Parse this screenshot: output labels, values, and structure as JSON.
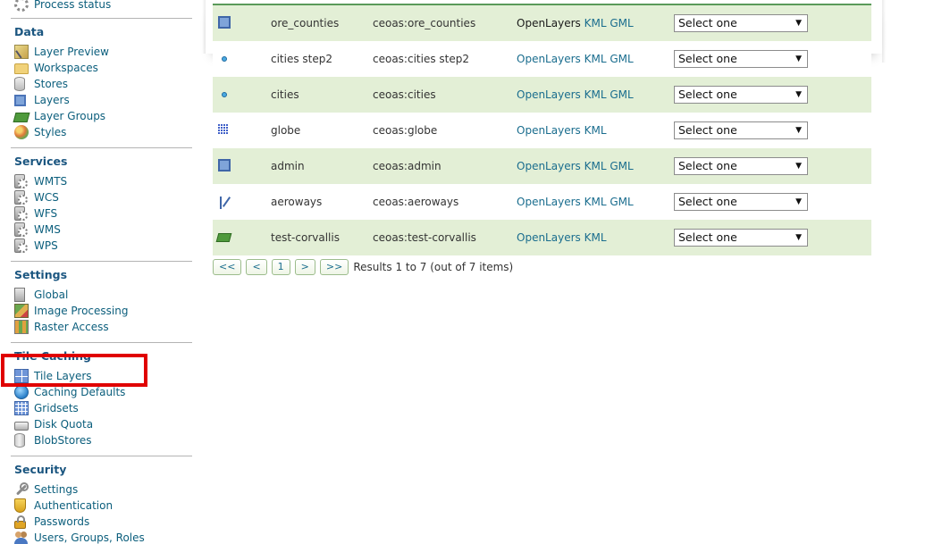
{
  "sidebar": {
    "top_item": {
      "label": "Process status",
      "icon": "gear-icon"
    },
    "sections": {
      "data": {
        "title": "Data",
        "items": [
          {
            "label": "Layer Preview",
            "icon": "layer-preview-icon"
          },
          {
            "label": "Workspaces",
            "icon": "folder-icon"
          },
          {
            "label": "Stores",
            "icon": "store-icon"
          },
          {
            "label": "Layers",
            "icon": "layer-icon"
          },
          {
            "label": "Layer Groups",
            "icon": "layer-group-icon"
          },
          {
            "label": "Styles",
            "icon": "palette-icon"
          }
        ]
      },
      "services": {
        "title": "Services",
        "items": [
          {
            "label": "WMTS",
            "icon": "service-icon"
          },
          {
            "label": "WCS",
            "icon": "service-icon"
          },
          {
            "label": "WFS",
            "icon": "service-icon"
          },
          {
            "label": "WMS",
            "icon": "service-icon"
          },
          {
            "label": "WPS",
            "icon": "service-icon"
          }
        ]
      },
      "settings": {
        "title": "Settings",
        "items": [
          {
            "label": "Global",
            "icon": "server-icon"
          },
          {
            "label": "Image Processing",
            "icon": "image-processing-icon"
          },
          {
            "label": "Raster Access",
            "icon": "raster-icon"
          }
        ]
      },
      "tile_caching": {
        "title": "Tile Caching",
        "items": [
          {
            "label": "Tile Layers",
            "icon": "tile-layers-icon"
          },
          {
            "label": "Caching Defaults",
            "icon": "globe-icon"
          },
          {
            "label": "Gridsets",
            "icon": "grid-icon"
          },
          {
            "label": "Disk Quota",
            "icon": "disk-icon"
          },
          {
            "label": "BlobStores",
            "icon": "blobstore-icon"
          }
        ]
      },
      "security": {
        "title": "Security",
        "items": [
          {
            "label": "Settings",
            "icon": "wrench-icon"
          },
          {
            "label": "Authentication",
            "icon": "shield-icon"
          },
          {
            "label": "Passwords",
            "icon": "lock-icon"
          },
          {
            "label": "Users, Groups, Roles",
            "icon": "users-icon"
          }
        ]
      }
    }
  },
  "layers_table": {
    "rows": [
      {
        "type_icon": "polygon-icon",
        "name": "ore_counties",
        "qualified": "ceoas:ore_counties",
        "openlayers": "OpenLayers",
        "kml": "KML",
        "gml": "GML",
        "select": "Select one"
      },
      {
        "type_icon": "point-icon",
        "name": "cities step2",
        "qualified": "ceoas:cities step2",
        "openlayers": "OpenLayers",
        "kml": "KML",
        "gml": "GML",
        "select": "Select one"
      },
      {
        "type_icon": "point-icon",
        "name": "cities",
        "qualified": "ceoas:cities",
        "openlayers": "OpenLayers",
        "kml": "KML",
        "gml": "GML",
        "select": "Select one"
      },
      {
        "type_icon": "raster-icon",
        "name": "globe",
        "qualified": "ceoas:globe",
        "openlayers": "OpenLayers",
        "kml": "KML",
        "gml": "",
        "select": "Select one"
      },
      {
        "type_icon": "polygon-icon",
        "name": "admin",
        "qualified": "ceoas:admin",
        "openlayers": "OpenLayers",
        "kml": "KML",
        "gml": "GML",
        "select": "Select one"
      },
      {
        "type_icon": "line-icon",
        "name": "aeroways",
        "qualified": "ceoas:aeroways",
        "openlayers": "OpenLayers",
        "kml": "KML",
        "gml": "GML",
        "select": "Select one"
      },
      {
        "type_icon": "layer-group-icon",
        "name": "test-corvallis",
        "qualified": "ceoas:test-corvallis",
        "openlayers": "OpenLayers",
        "kml": "KML",
        "gml": "",
        "select": "Select one"
      }
    ]
  },
  "pager": {
    "first": "<<",
    "prev": "<",
    "page": "1",
    "next": ">",
    "last": ">>",
    "summary": "Results 1 to 7 (out of 7 items)"
  },
  "colors": {
    "link": "#1a6d8e",
    "section_title": "#1b5680",
    "row_alt": "#e3efd6",
    "highlight_box": "#e00000"
  }
}
